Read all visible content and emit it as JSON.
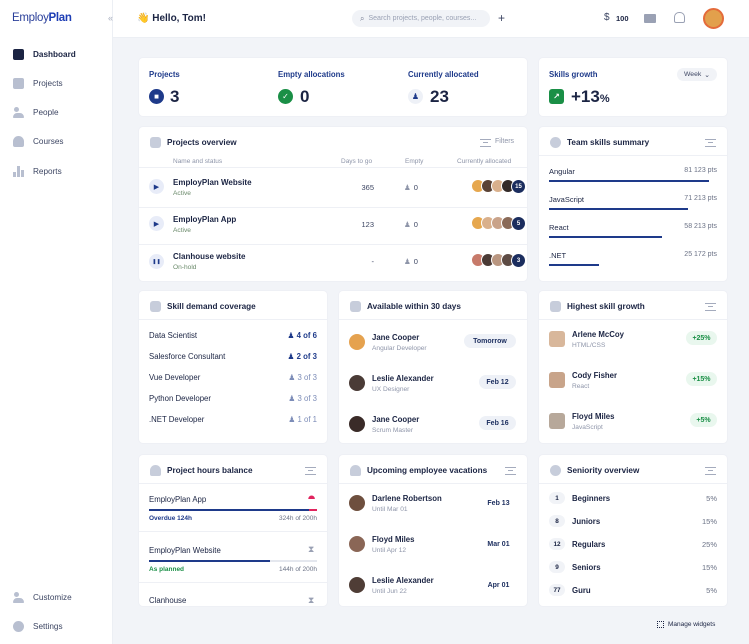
{
  "logo": {
    "part1": "Employ",
    "part2": "Plan"
  },
  "sidebar": {
    "collapse": "«",
    "items": [
      {
        "label": "Dashboard"
      },
      {
        "label": "Projects"
      },
      {
        "label": "People"
      },
      {
        "label": "Courses"
      },
      {
        "label": "Reports"
      }
    ],
    "bottom": [
      {
        "label": "Customize"
      },
      {
        "label": "Settings"
      }
    ]
  },
  "topbar": {
    "greeting": "👋 Hello, Tom!",
    "search_placeholder": "Search projects, people, courses...",
    "plus": "+",
    "currency": "$",
    "credits": "100"
  },
  "kpis": {
    "projects": {
      "label": "Projects",
      "value": "3"
    },
    "empty": {
      "label": "Empty allocations",
      "value": "0"
    },
    "allocated": {
      "label": "Currently allocated",
      "value": "23"
    },
    "skills": {
      "label": "Skills growth",
      "value": "+13",
      "unit": "%",
      "period": "Week"
    }
  },
  "projects_overview": {
    "title": "Projects overview",
    "filters": "Filters",
    "headers": [
      "Name and status",
      "Days to go",
      "Empty",
      "Currently allocated"
    ],
    "rows": [
      {
        "name": "EmployPlan Website",
        "status": "Active",
        "days": "365",
        "empty": "0",
        "more": "15",
        "icon": "▶"
      },
      {
        "name": "EmployPlan App",
        "status": "Active",
        "days": "123",
        "empty": "0",
        "more": "5",
        "icon": "▶"
      },
      {
        "name": "Clanhouse website",
        "status": "On-hold",
        "days": "-",
        "empty": "0",
        "more": "3",
        "icon": "❚❚"
      }
    ]
  },
  "team_skills": {
    "title": "Team skills summary",
    "rows": [
      {
        "name": "Angular",
        "pts": "81 123 pts",
        "pct": 0.95
      },
      {
        "name": "JavaScript",
        "pts": "71 213 pts",
        "pct": 0.83
      },
      {
        "name": "React",
        "pts": "58 213 pts",
        "pct": 0.67
      },
      {
        "name": ".NET",
        "pts": "25 172 pts",
        "pct": 0.3
      }
    ]
  },
  "skill_demand": {
    "title": "Skill demand coverage",
    "rows": [
      {
        "name": "Data Scientist",
        "val": "4 of 6",
        "ok": true
      },
      {
        "name": "Salesforce Consultant",
        "val": "2 of 3",
        "ok": true
      },
      {
        "name": "Vue Developer",
        "val": "3 of 3",
        "ok": false
      },
      {
        "name": "Python Developer",
        "val": "3 of 3",
        "ok": false
      },
      {
        "name": ".NET Developer",
        "val": "1 of 1",
        "ok": false
      }
    ]
  },
  "available": {
    "title": "Available within 30 days",
    "rows": [
      {
        "name": "Jane Cooper",
        "role": "Angular Developer",
        "when": "Tomorrow"
      },
      {
        "name": "Leslie Alexander",
        "role": "UX Designer",
        "when": "Feb 12"
      },
      {
        "name": "Jane Cooper",
        "role": "Scrum Master",
        "when": "Feb 16"
      }
    ]
  },
  "highest_growth": {
    "title": "Highest skill growth",
    "rows": [
      {
        "name": "Arlene McCoy",
        "skill": "HTML/CSS",
        "pct": "+25%"
      },
      {
        "name": "Cody Fisher",
        "skill": "React",
        "pct": "+15%"
      },
      {
        "name": "Floyd Miles",
        "skill": "JavaScript",
        "pct": "+5%"
      }
    ]
  },
  "hours": {
    "title": "Project hours balance",
    "rows": [
      {
        "name": "EmployPlan App",
        "status": "Overdue 124h",
        "hours": "324h of 200h",
        "ratio": 1.0
      },
      {
        "name": "EmployPlan Website",
        "status": "As planned",
        "hours": "144h of 200h",
        "ratio": 0.72
      },
      {
        "name": "Clanhouse",
        "status": "",
        "hours": "",
        "ratio": 0
      }
    ]
  },
  "vacations": {
    "title": "Upcoming employee vacations",
    "rows": [
      {
        "name": "Darlene Robertson",
        "until": "Until Mar 01",
        "date": "Feb 13"
      },
      {
        "name": "Floyd Miles",
        "until": "Until Apr 12",
        "date": "Mar 01"
      },
      {
        "name": "Leslie Alexander",
        "until": "Until Jun 22",
        "date": "Apr 01"
      }
    ]
  },
  "seniority": {
    "title": "Seniority overview",
    "rows": [
      {
        "count": "1",
        "level": "Beginners",
        "pct": "5%"
      },
      {
        "count": "8",
        "level": "Juniors",
        "pct": "15%"
      },
      {
        "count": "12",
        "level": "Regulars",
        "pct": "25%"
      },
      {
        "count": "9",
        "level": "Seniors",
        "pct": "15%"
      },
      {
        "count": "77",
        "level": "Guru",
        "pct": "5%"
      }
    ]
  },
  "footer": {
    "manage": "Manage widgets"
  },
  "colors": {
    "accent": "#1e3a8a",
    "green": "#1a8f46",
    "red": "#e0245e"
  }
}
